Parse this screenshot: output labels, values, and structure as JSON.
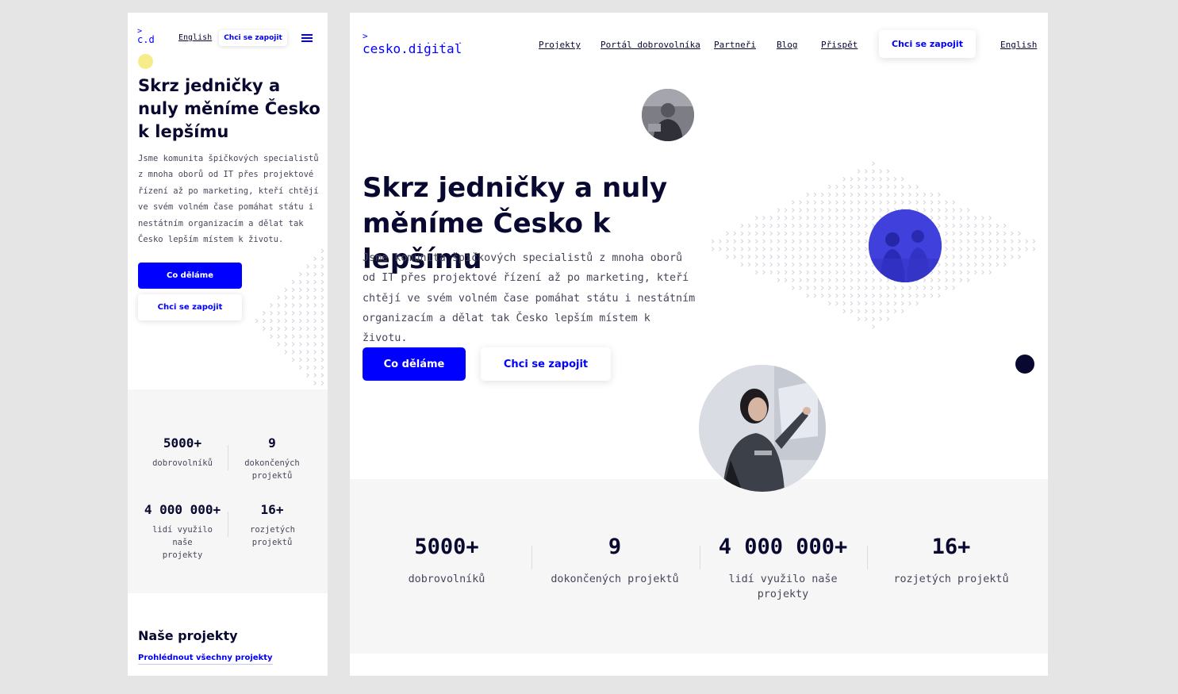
{
  "brand": {
    "logo_short": "c.d",
    "logo_full": "cesko.digital",
    "logo_chevron": ">",
    "logo_dots": "..."
  },
  "nav": {
    "items": [
      "Projekty",
      "Portál dobrovolníka",
      "Partneři",
      "Blog",
      "Přispět"
    ],
    "join": "Chci se zapojit",
    "language": "English"
  },
  "hero": {
    "title": "Skrz jedničky a nuly měníme Česko k lepšímu",
    "description": "Jsme komunita špičkových specialistů z mnoha oborů od IT přes projektové řízení až po marketing, kteří chtějí ve svém volném čase pomáhat státu i nestátním organizacím a dělat tak Česko lepším místem k životu.",
    "primary_button": "Co děláme",
    "secondary_button": "Chci se zapojit"
  },
  "stats": [
    {
      "value": "5000+",
      "label": "dobrovolníků"
    },
    {
      "value": "9",
      "label": "dokončených projektů"
    },
    {
      "value": "4 000 000+",
      "label": "lidí využilo naše projekty"
    },
    {
      "value": "16+",
      "label": "rozjetých projektů"
    }
  ],
  "projects": {
    "title": "Naše projekty",
    "link": "Prohlédnout všechny projekty"
  },
  "colors": {
    "accent": "#0000ff",
    "dark": "#080831",
    "text": "#47475b",
    "stats_bg": "#f6f6f6",
    "yellow": "#f6ec8a"
  }
}
